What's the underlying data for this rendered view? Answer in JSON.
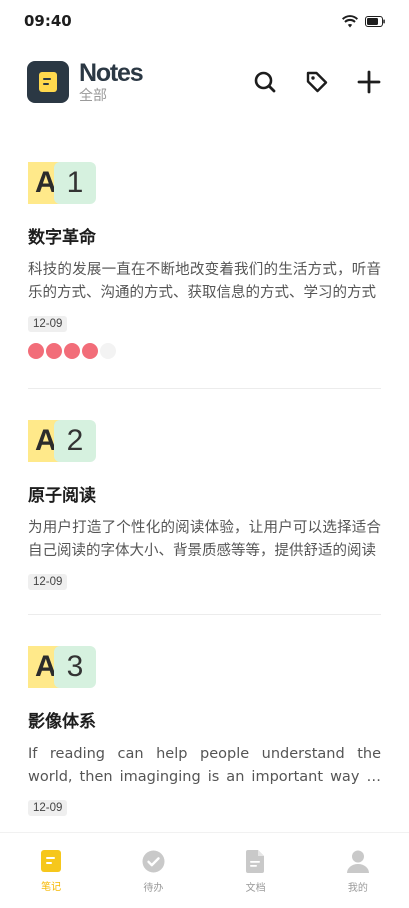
{
  "status": {
    "time": "09:40"
  },
  "header": {
    "title": "Notes",
    "subtitle": "全部"
  },
  "notes": [
    {
      "letter": "A",
      "number": "1",
      "title": "数字革命",
      "body": "科技的发展一直在不断地改变着我们的生活方式，听音乐的方式、沟通的方式、获取信息的方式、学习的方式",
      "date": "12-09",
      "rating": 4,
      "rating_max": 5
    },
    {
      "letter": "A",
      "number": "2",
      "title": "原子阅读",
      "body": "为用户打造了个性化的阅读体验，让用户可以选择适合自己阅读的字体大小、背景质感等等，提供舒适的阅读",
      "date": "12-09"
    },
    {
      "letter": "A",
      "number": "3",
      "title": "影像体系",
      "body": "If reading can help people understand the world, then imaginging is an important way to record the world",
      "date": "12-09"
    }
  ],
  "tabs": [
    {
      "label": "笔记",
      "icon": "note-icon",
      "active": true
    },
    {
      "label": "待办",
      "icon": "check-circle-icon",
      "active": false
    },
    {
      "label": "文档",
      "icon": "document-icon",
      "active": false
    },
    {
      "label": "我的",
      "icon": "user-icon",
      "active": false
    }
  ],
  "colors": {
    "accent": "#f6b800",
    "brand": "#2b3844",
    "rating": "#f26d79"
  }
}
